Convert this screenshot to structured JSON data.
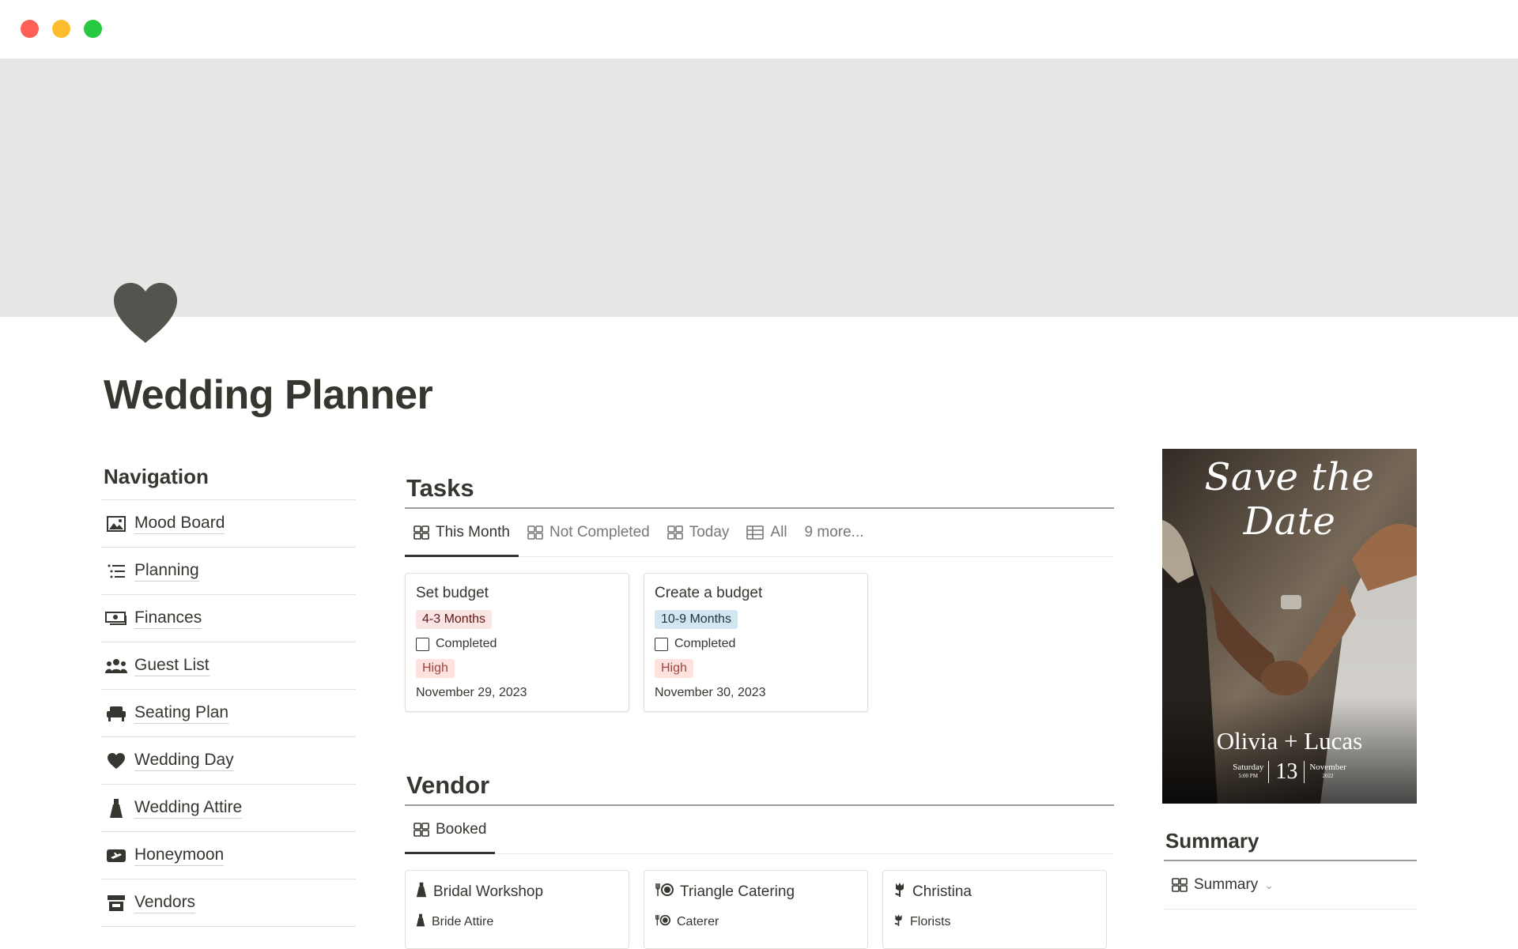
{
  "page": {
    "title": "Wedding Planner"
  },
  "navigation": {
    "heading": "Navigation",
    "items": [
      {
        "label": "Mood Board",
        "icon": "image-icon"
      },
      {
        "label": "Planning",
        "icon": "list-icon"
      },
      {
        "label": "Finances",
        "icon": "money-icon"
      },
      {
        "label": "Guest List",
        "icon": "people-icon"
      },
      {
        "label": "Seating Plan",
        "icon": "sofa-icon"
      },
      {
        "label": "Wedding Day",
        "icon": "heart-icon"
      },
      {
        "label": "Wedding Attire",
        "icon": "dress-icon"
      },
      {
        "label": "Honeymoon",
        "icon": "plane-icon"
      },
      {
        "label": "Vendors",
        "icon": "store-icon"
      }
    ]
  },
  "tasks": {
    "title": "Tasks",
    "tabs": [
      "This Month",
      "Not Completed",
      "Today",
      "All"
    ],
    "more": "9 more...",
    "cards": [
      {
        "title": "Set budget",
        "timeframe": "4-3 Months",
        "completed_label": "Completed",
        "priority": "High",
        "date": "November 29, 2023"
      },
      {
        "title": "Create a budget",
        "timeframe": "10-9 Months",
        "completed_label": "Completed",
        "priority": "High",
        "date": "November 30, 2023"
      }
    ]
  },
  "vendor": {
    "title": "Vendor",
    "tab": "Booked",
    "cards": [
      {
        "title": "Bridal Workshop",
        "category": "Bride Attire",
        "icon": "dress-icon"
      },
      {
        "title": "Triangle Catering",
        "category": "Caterer",
        "icon": "dining-icon"
      },
      {
        "title": "Christina",
        "category": "Florists",
        "icon": "flower-icon"
      }
    ]
  },
  "poster": {
    "headline": "Save the Date",
    "names": "Olivia + Lucas",
    "weekday": "Saturday",
    "time": "5:00 PM",
    "day": "13",
    "month": "November",
    "year": "2022"
  },
  "summary": {
    "title": "Summary",
    "tab": "Summary"
  },
  "colors": {
    "cover": "#e7e7e5",
    "text": "#37352f",
    "muted": "#787774"
  }
}
